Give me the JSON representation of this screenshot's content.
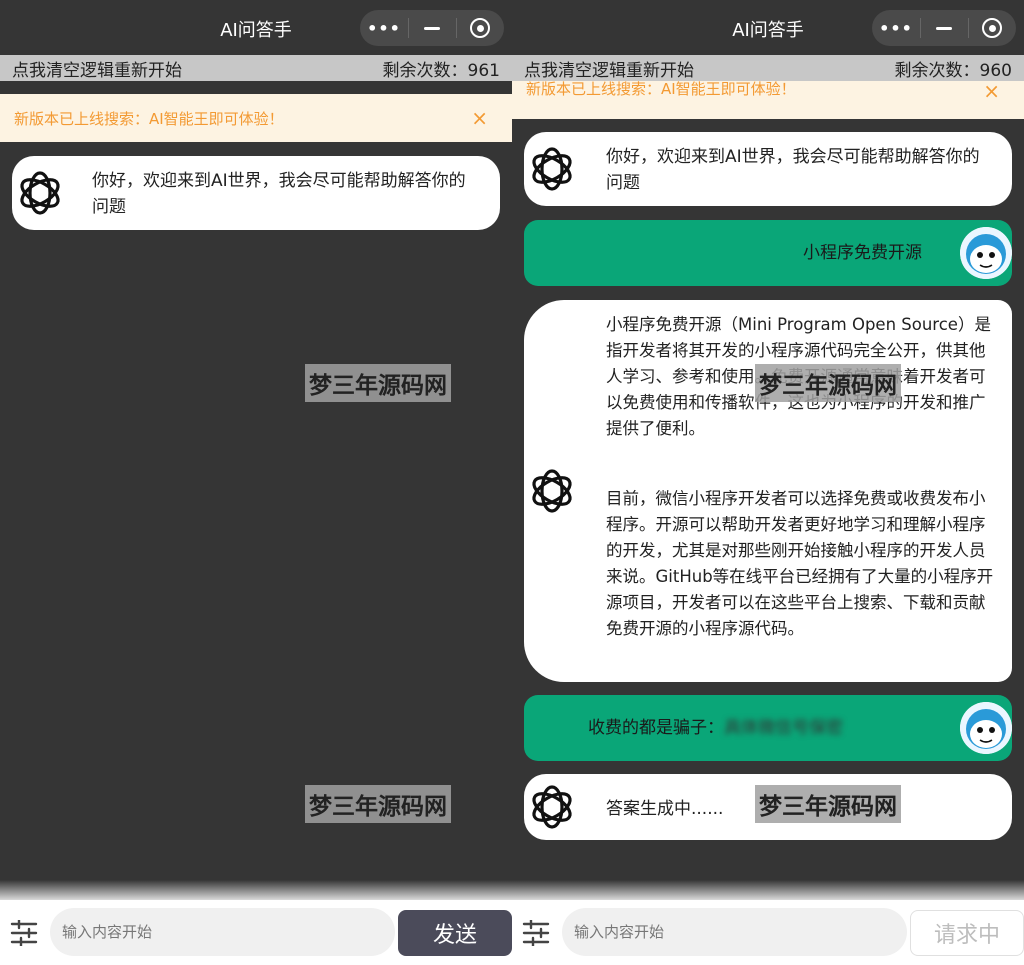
{
  "left": {
    "title": "AI问答手",
    "clear_text": "点我清空逻辑重新开始",
    "remaining": "剩余次数：961",
    "notice": "新版本已上线搜索：AI智能王即可体验！",
    "notice_close": "×",
    "welcome": "你好，欢迎来到AI世界，我会尽可能帮助解答你的问题",
    "watermark": "梦三年源码网",
    "input_placeholder": "输入内容开始",
    "send_label": "发送"
  },
  "right": {
    "title": "AI问答手",
    "clear_text": "点我清空逻辑重新开始",
    "remaining": "剩余次数：960",
    "notice": "新版本已上线搜索：AI智能王即可体验！",
    "notice_close": "×",
    "welcome": "你好，欢迎来到AI世界，我会尽可能帮助解答你的问题",
    "user_q1": "小程序免费开源",
    "answer_p1": "小程序免费开源（Mini Program Open Source）是指开发者将其开发的小程序源代码完全公开，供其他人学习、参考和使用。免费开源通常意味着开发者可以免费使用和传播软件，这也为小程序的开发和推广提供了便利。",
    "answer_p2": "目前，微信小程序开发者可以选择免费或收费发布小程序。开源可以帮助开发者更好地学习和理解小程序的开发，尤其是对那些刚开始接触小程序的开发人员来说。GitHub等在线平台已经拥有了大量的小程序开源项目，开发者可以在这些平台上搜索、下载和贡献免费开源的小程序源代码。",
    "user_q2": "收费的都是骗子：",
    "pending": "答案生成中......",
    "watermark": "梦三年源码网",
    "input_placeholder": "输入内容开始",
    "send_label": "请求中"
  },
  "colors": {
    "accent_green": "#0aa678",
    "notice_orange": "#f39a33",
    "send_dark": "#4b4b5a"
  },
  "icons": {
    "bot": "openai-logo-icon",
    "user": "cartoon-avatar-icon",
    "settings": "sliders-icon"
  }
}
